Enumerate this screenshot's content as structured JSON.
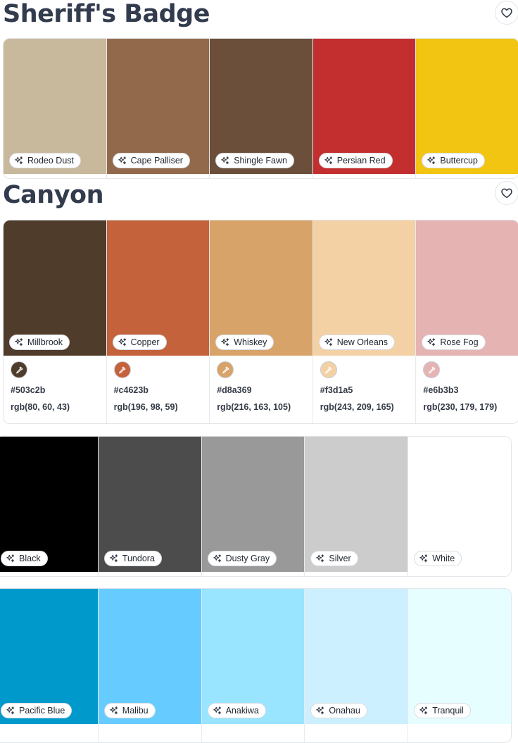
{
  "palettes": [
    {
      "title": "Sheriff's Badge",
      "colors": [
        {
          "name": "Rodeo Dust",
          "color": "#c8b89c"
        },
        {
          "name": "Cape Palliser",
          "color": "#926a4b"
        },
        {
          "name": "Shingle Fawn",
          "color": "#6b4f3a"
        },
        {
          "name": "Persian Red",
          "color": "#c32f2f"
        },
        {
          "name": "Buttercup",
          "color": "#f1c511"
        }
      ]
    },
    {
      "title": "Canyon",
      "colors": [
        {
          "name": "Millbrook",
          "color": "#503c2b",
          "hex": "#503c2b",
          "rgb": "rgb(80, 60, 43)"
        },
        {
          "name": "Copper",
          "color": "#c4623b",
          "hex": "#c4623b",
          "rgb": "rgb(196, 98, 59)"
        },
        {
          "name": "Whiskey",
          "color": "#d8a369",
          "hex": "#d8a369",
          "rgb": "rgb(216, 163, 105)"
        },
        {
          "name": "New Orleans",
          "color": "#f3d1a5",
          "hex": "#f3d1a5",
          "rgb": "rgb(243, 209, 165)"
        },
        {
          "name": "Rose Fog",
          "color": "#e6b3b3",
          "hex": "#e6b3b3",
          "rgb": "rgb(230, 179, 179)"
        }
      ]
    },
    {
      "title": "",
      "colors": [
        {
          "name": "Black",
          "color": "#000000"
        },
        {
          "name": "Tundora",
          "color": "#4c4c4c"
        },
        {
          "name": "Dusty Gray",
          "color": "#999999"
        },
        {
          "name": "Silver",
          "color": "#cccccc"
        },
        {
          "name": "White",
          "color": "#ffffff"
        }
      ]
    },
    {
      "title": "",
      "colors": [
        {
          "name": "Pacific Blue",
          "color": "#0099cc"
        },
        {
          "name": "Malibu",
          "color": "#66ccff"
        },
        {
          "name": "Anakiwa",
          "color": "#99e5ff"
        },
        {
          "name": "Onahau",
          "color": "#ccf0ff"
        },
        {
          "name": "Tranquil",
          "color": "#e6feff"
        }
      ]
    }
  ],
  "icons": {
    "favorite": "heart-icon",
    "generate": "sparkles-icon",
    "picker": "eyedropper-icon"
  }
}
